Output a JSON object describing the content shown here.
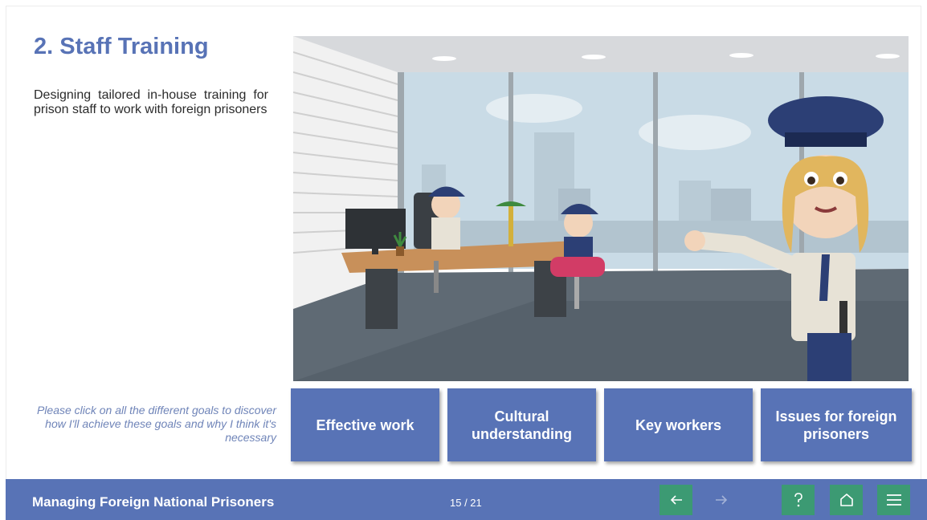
{
  "slide": {
    "title": "2. Staff Training",
    "body": "Designing tailored in-house training for prison staff to work with foreign prisoners",
    "hint": "Please click on all the different goals to discover how I'll achieve these goals and why I think it's necessary"
  },
  "goals": [
    {
      "label": "Effective work"
    },
    {
      "label": "Cultural understanding"
    },
    {
      "label": "Key workers"
    },
    {
      "label": "Issues for foreign prisoners"
    }
  ],
  "footer": {
    "course_title": "Managing Foreign National Prisoners",
    "page_indicator": "15 / 21",
    "buttons": [
      {
        "icon": "arrow-left-icon"
      },
      {
        "icon": "arrow-right-icon"
      },
      {
        "icon": "question-icon"
      },
      {
        "icon": "home-icon"
      },
      {
        "icon": "menu-icon"
      }
    ]
  },
  "colors": {
    "accent": "#5873b6",
    "nav_button": "#3c9a73",
    "hint_text": "#6f84b8"
  }
}
